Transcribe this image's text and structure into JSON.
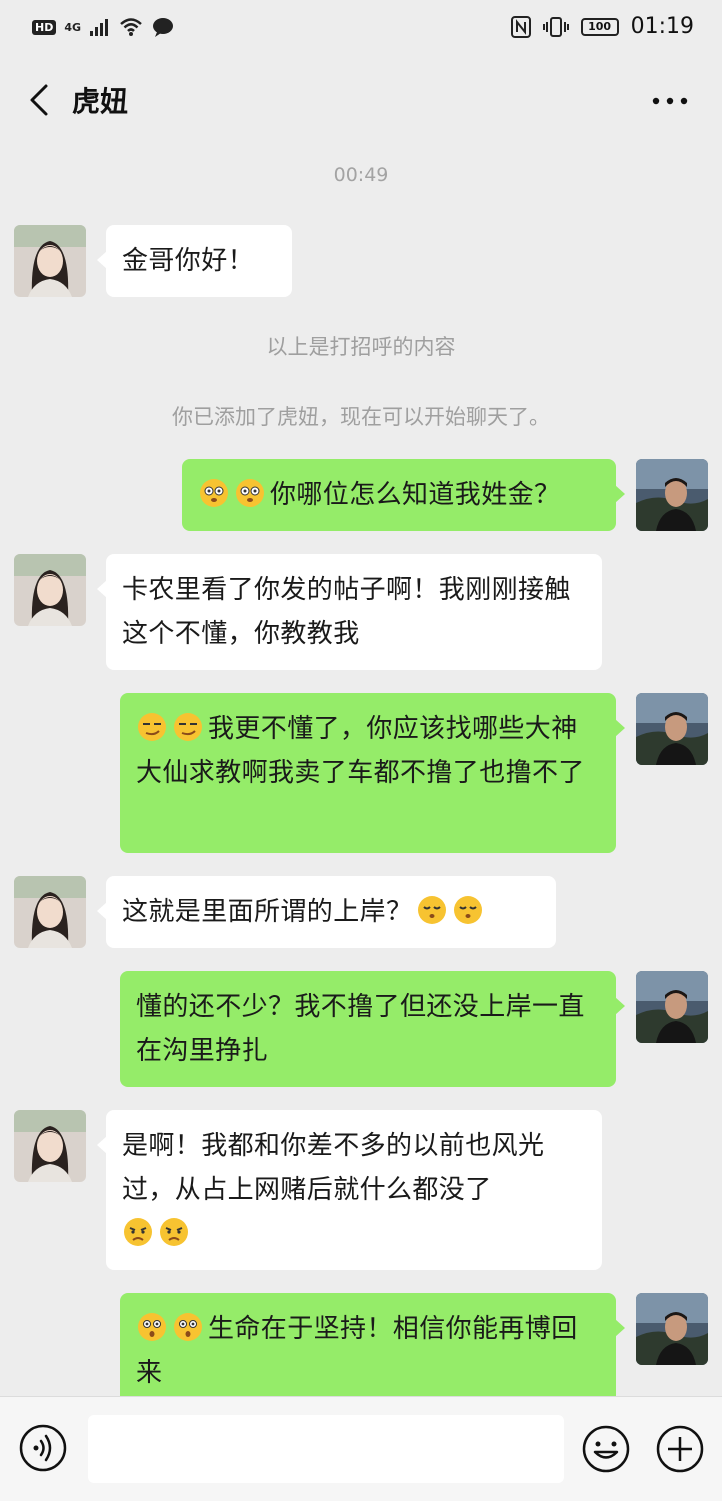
{
  "status_bar": {
    "hd": "HD",
    "network": "4G",
    "battery": "100",
    "time": "01:19"
  },
  "header": {
    "title": "虎妞"
  },
  "chat": {
    "timestamp": "00:49",
    "system_notes": [
      "以上是打招呼的内容",
      "你已添加了虎妞，现在可以开始聊天了。"
    ],
    "messages": [
      {
        "side": "in",
        "text": "金哥你好！",
        "emoji": ""
      },
      {
        "side": "out",
        "text": "你哪位怎么知道我姓金？",
        "emoji": "dizzy-face-emoji"
      },
      {
        "side": "in",
        "text": "卡农里看了你发的帖子啊！我刚刚接触这个不懂，你教教我",
        "emoji": ""
      },
      {
        "side": "out",
        "text": "我更不懂了，你应该找哪些大神大仙求教啊我卖了车都不撸了也撸不了",
        "emoji": "smirk-emoji"
      },
      {
        "side": "in",
        "text": "这就是里面所谓的上岸？",
        "emoji": "pensive-emoji"
      },
      {
        "side": "out",
        "text": "懂的还不少？我不撸了但还没上岸一直在沟里挣扎",
        "emoji": ""
      },
      {
        "side": "in",
        "text": "是啊！我都和你差不多的以前也风光过，从占上网赌后就什么都没了",
        "emoji": "sad-emoji"
      },
      {
        "side": "out",
        "text": "生命在于坚持！相信你能再博回来",
        "emoji": "surprised-emoji"
      }
    ]
  },
  "input": {
    "placeholder": ""
  },
  "colors": {
    "background": "#ededed",
    "outgoing_bubble": "#95ec69",
    "incoming_bubble": "#ffffff"
  }
}
